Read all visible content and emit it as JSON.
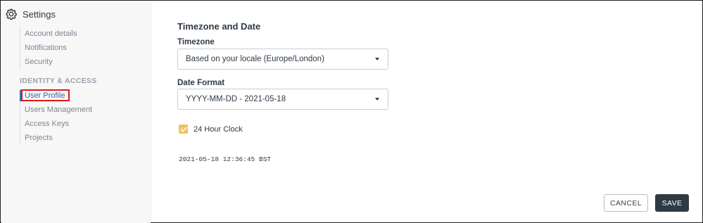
{
  "sidebar": {
    "settings_label": "Settings",
    "group1": {
      "items": [
        {
          "label": "Account details"
        },
        {
          "label": "Notifications"
        },
        {
          "label": "Security"
        }
      ]
    },
    "section_title": "IDENTITY & ACCESS",
    "group2": {
      "items": [
        {
          "label": "User Profile",
          "active": true
        },
        {
          "label": "Users Management"
        },
        {
          "label": "Access Keys"
        },
        {
          "label": "Projects"
        }
      ]
    }
  },
  "main": {
    "title": "Timezone and Date",
    "timezone": {
      "label": "Timezone",
      "value": "Based on your locale (Europe/London)"
    },
    "date_format": {
      "label": "Date Format",
      "value": "YYYY-MM-DD - 2021-05-18"
    },
    "clock": {
      "label": "24 Hour Clock",
      "checked": true
    },
    "timestamp": "2021-05-18 12:36:45 BST"
  },
  "buttons": {
    "cancel": "CANCEL",
    "save": "SAVE"
  },
  "colors": {
    "accent": "#2d6bb6",
    "highlight": "#e21818",
    "checkbox": "#f0c35a",
    "save_bg": "#2f3a45"
  },
  "icons": {
    "settings": "gear-icon",
    "dropdown": "chevron-down-icon",
    "check": "check-icon"
  }
}
